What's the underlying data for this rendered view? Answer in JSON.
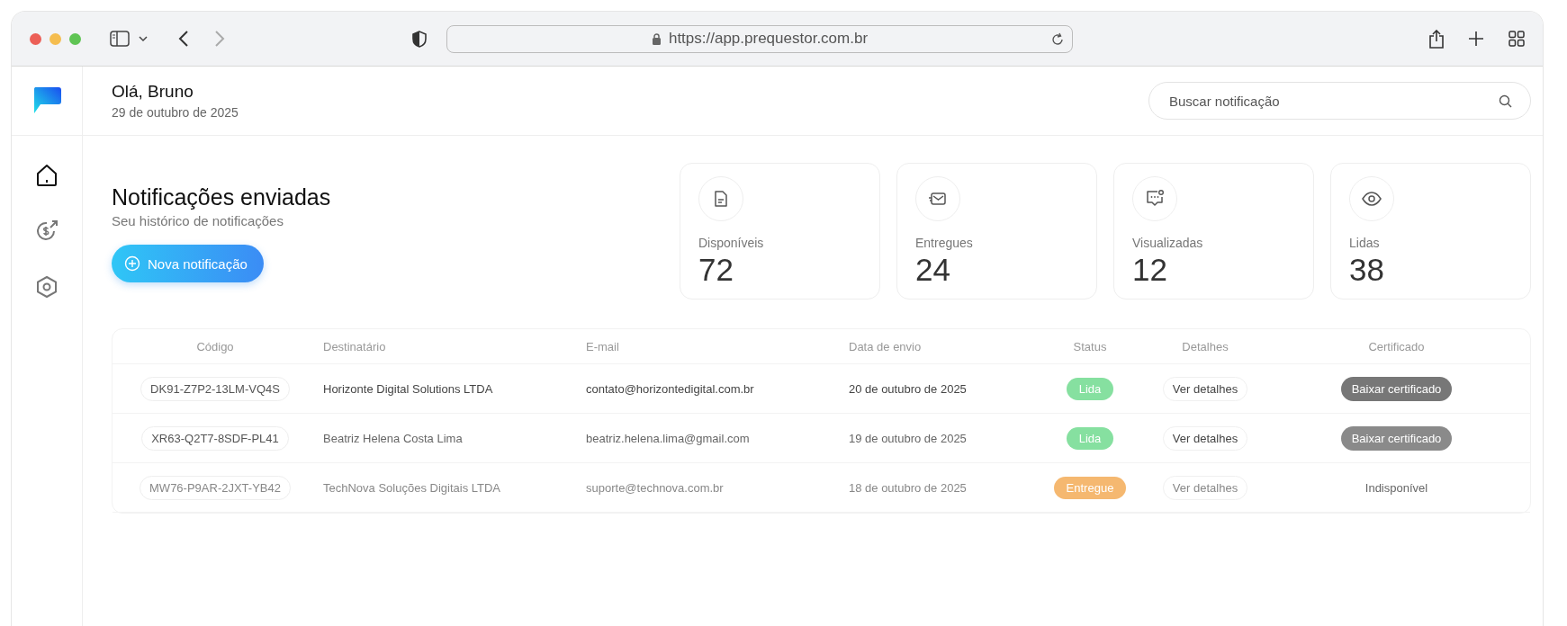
{
  "browser": {
    "url": "https://app.prequestor.com.br"
  },
  "header": {
    "greeting": "Olá, Bruno",
    "date": "29 de outubro de 2025",
    "search": {
      "placeholder": "Buscar notificação"
    }
  },
  "sidebar": {
    "items": [
      {
        "kind": "home",
        "selected": true
      },
      {
        "kind": "money",
        "selected": false
      },
      {
        "kind": "settings",
        "selected": false
      }
    ]
  },
  "page": {
    "title": "Notificações enviadas",
    "subtitle": "Seu histórico de notificações",
    "new_button": "Nova notificação"
  },
  "stats": [
    {
      "kind": "document",
      "label": "Disponíveis",
      "value": "72"
    },
    {
      "kind": "mail",
      "label": "Entregues",
      "value": "24"
    },
    {
      "kind": "chat",
      "label": "Visualizadas",
      "value": "12"
    },
    {
      "kind": "eye",
      "label": "Lidas",
      "value": "38"
    }
  ],
  "table": {
    "columns": [
      "Código",
      "Destinatário",
      "E-mail",
      "Data de envio",
      "Status",
      "Detalhes",
      "Certificado"
    ],
    "rows": [
      {
        "code": "DK91-Z7P2-13LM-VQ4S",
        "recipient": "Horizonte Digital Solutions LTDA",
        "email": "contato@horizontedigital.com.br",
        "date": "20 de outubro de 2025",
        "status": "Lida",
        "color": "#86e0a0",
        "details": "Ver detalhes",
        "certificate": "Baixar certificado",
        "certificate_available": true
      },
      {
        "code": "XR63-Q2T7-8SDF-PL41",
        "recipient": "Beatriz Helena Costa Lima",
        "email": "beatriz.helena.lima@gmail.com",
        "date": "19 de outubro de 2025",
        "status": "Lida",
        "color": "#86e0a0",
        "details": "Ver detalhes",
        "certificate": "Baixar certificado",
        "certificate_available": true
      },
      {
        "code": "MW76-P9AR-2JXT-YB42",
        "recipient": "TechNova Soluções Digitais LTDA",
        "email": "suporte@technova.com.br",
        "date": "18 de outubro de 2025",
        "status": "Entregue",
        "color": "#f5b870",
        "details": "Ver detalhes",
        "certificate": "Indisponível",
        "certificate_available": false
      }
    ]
  }
}
